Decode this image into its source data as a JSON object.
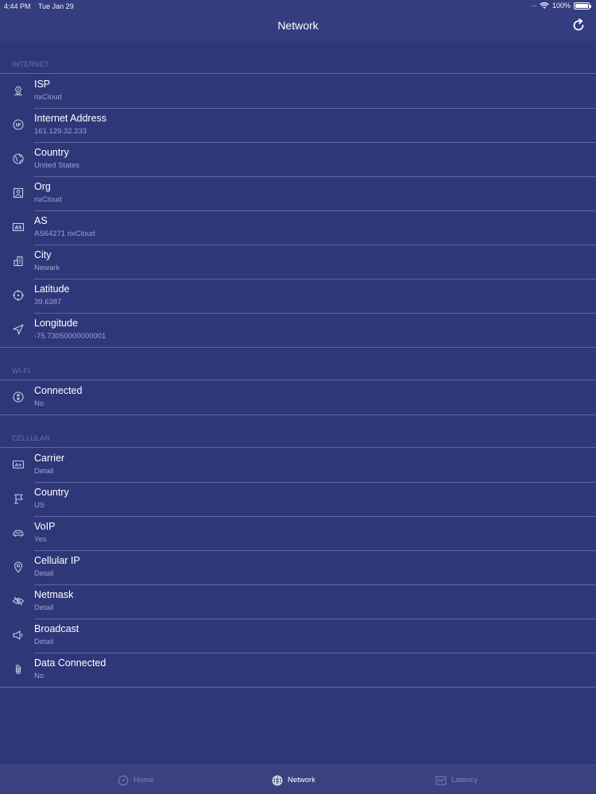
{
  "status_bar": {
    "time": "4:44 PM",
    "date": "Tue Jan 29",
    "battery": "100%"
  },
  "nav": {
    "title": "Network",
    "refresh_icon": "refresh-icon"
  },
  "sections": {
    "internet": {
      "header": "INTERNET",
      "rows": [
        {
          "title": "ISP",
          "detail": "rixCloud",
          "icon": "isp-icon"
        },
        {
          "title": "Internet Address",
          "detail": "161.129.32.233",
          "icon": "ip-icon"
        },
        {
          "title": "Country",
          "detail": "United States",
          "icon": "globe-icon"
        },
        {
          "title": "Org",
          "detail": "rixCloud",
          "icon": "org-icon"
        },
        {
          "title": "AS",
          "detail": "AS64271 rixCloud",
          "icon": "as-icon"
        },
        {
          "title": "City",
          "detail": "Newark",
          "icon": "city-icon"
        },
        {
          "title": "Latitude",
          "detail": "39.6387",
          "icon": "crosshair-icon"
        },
        {
          "title": "Longitude",
          "detail": "-75.73050000000001",
          "icon": "location-arrow-icon"
        }
      ]
    },
    "wifi": {
      "header": "WI-FI",
      "rows": [
        {
          "title": "Connected",
          "detail": "No",
          "icon": "wifi-connected-icon"
        }
      ]
    },
    "cellular": {
      "header": "CELLULAR",
      "rows": [
        {
          "title": "Carrier",
          "detail": "Detail",
          "icon": "carrier-icon"
        },
        {
          "title": "Country",
          "detail": "US",
          "icon": "flag-icon"
        },
        {
          "title": "VoIP",
          "detail": "Yes",
          "icon": "voip-icon"
        },
        {
          "title": "Cellular IP",
          "detail": "Detail",
          "icon": "location-pin-icon"
        },
        {
          "title": "Netmask",
          "detail": "Detail",
          "icon": "eye-slash-icon"
        },
        {
          "title": "Broadcast",
          "detail": "Detail",
          "icon": "broadcast-icon"
        },
        {
          "title": "Data Connected",
          "detail": "No",
          "icon": "paperclip-icon"
        }
      ]
    }
  },
  "tabs": [
    {
      "label": "Home",
      "icon": "speedometer-icon",
      "active": false
    },
    {
      "label": "Network",
      "icon": "globe-icon",
      "active": true
    },
    {
      "label": "Latency",
      "icon": "chart-icon",
      "active": false
    }
  ],
  "colors": {
    "background": "#2e3778",
    "separator": "#5d66a4",
    "detail_text": "#9da3d0",
    "section_header": "#6a72ab"
  }
}
